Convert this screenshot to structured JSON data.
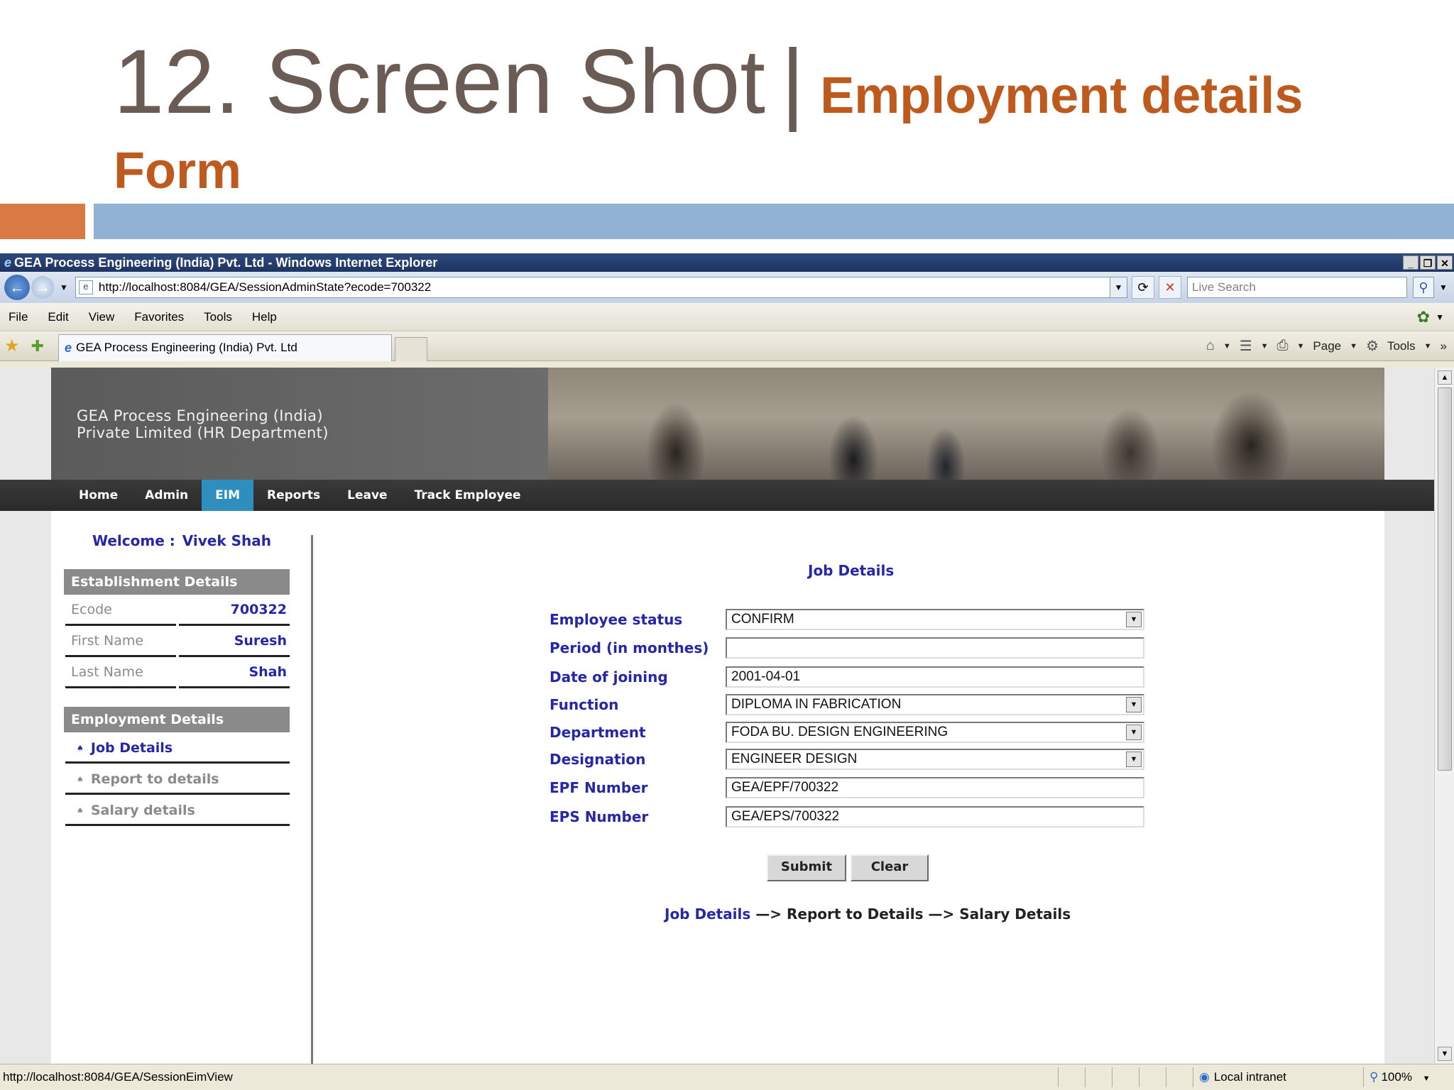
{
  "slide": {
    "title_main": "12. Screen Shot",
    "title_sep": "|",
    "title_sub": "Employment details",
    "title_sub_line2": "Form",
    "accent_orange": "#d97a45",
    "accent_blue": "#92b2d4"
  },
  "browser": {
    "window_title": "GEA Process Engineering (India) Pvt. Ltd - Windows Internet Explorer",
    "url": "http://localhost:8084/GEA/SessionAdminState?ecode=700322",
    "search_placeholder": "Live Search",
    "menu": [
      "File",
      "Edit",
      "View",
      "Favorites",
      "Tools",
      "Help"
    ],
    "tab_title": "GEA Process Engineering (India) Pvt. Ltd",
    "tab_tools": {
      "page": "Page",
      "tools": "Tools"
    },
    "status_url": "http://localhost:8084/GEA/SessionEimView",
    "zone": "Local intranet",
    "zoom": "100%"
  },
  "site": {
    "company_line1": "GEA Process Engineering (India)",
    "company_line2": "Private Limited (HR Department)",
    "nav": [
      "Home",
      "Admin",
      "EIM",
      "Reports",
      "Leave",
      "Track Employee"
    ],
    "active_nav": "EIM",
    "nav_active_color": "#2e8fbf"
  },
  "sidebar": {
    "welcome_label": "Welcome :",
    "welcome_name": "Vivek Shah",
    "establishment_header": "Establishment Details",
    "fields": [
      {
        "label": "Ecode",
        "value": "700322"
      },
      {
        "label": "First Name",
        "value": "Suresh"
      },
      {
        "label": "Last Name",
        "value": "Shah"
      }
    ],
    "employment_header": "Employment Details",
    "links": [
      "Job Details",
      "Report to details",
      "Salary details"
    ]
  },
  "form": {
    "title": "Job Details",
    "fields": [
      {
        "label": "Employee status",
        "value": "CONFIRM",
        "type": "select"
      },
      {
        "label": "Period (in monthes)",
        "value": "",
        "type": "text"
      },
      {
        "label": "Date of joining",
        "value": "2001-04-01",
        "type": "text"
      },
      {
        "label": "Function",
        "value": "DIPLOMA IN FABRICATION",
        "type": "select"
      },
      {
        "label": "Department",
        "value": "FODA BU. DESIGN ENGINEERING",
        "type": "select"
      },
      {
        "label": "Designation",
        "value": "ENGINEER DESIGN",
        "type": "select"
      },
      {
        "label": "EPF Number",
        "value": "GEA/EPF/700322",
        "type": "text"
      },
      {
        "label": "EPS Number",
        "value": "GEA/EPS/700322",
        "type": "text"
      }
    ],
    "submit_label": "Submit",
    "clear_label": "Clear",
    "flow_step1": "Job Details",
    "flow_rest": " —> Report to Details —> Salary Details"
  }
}
